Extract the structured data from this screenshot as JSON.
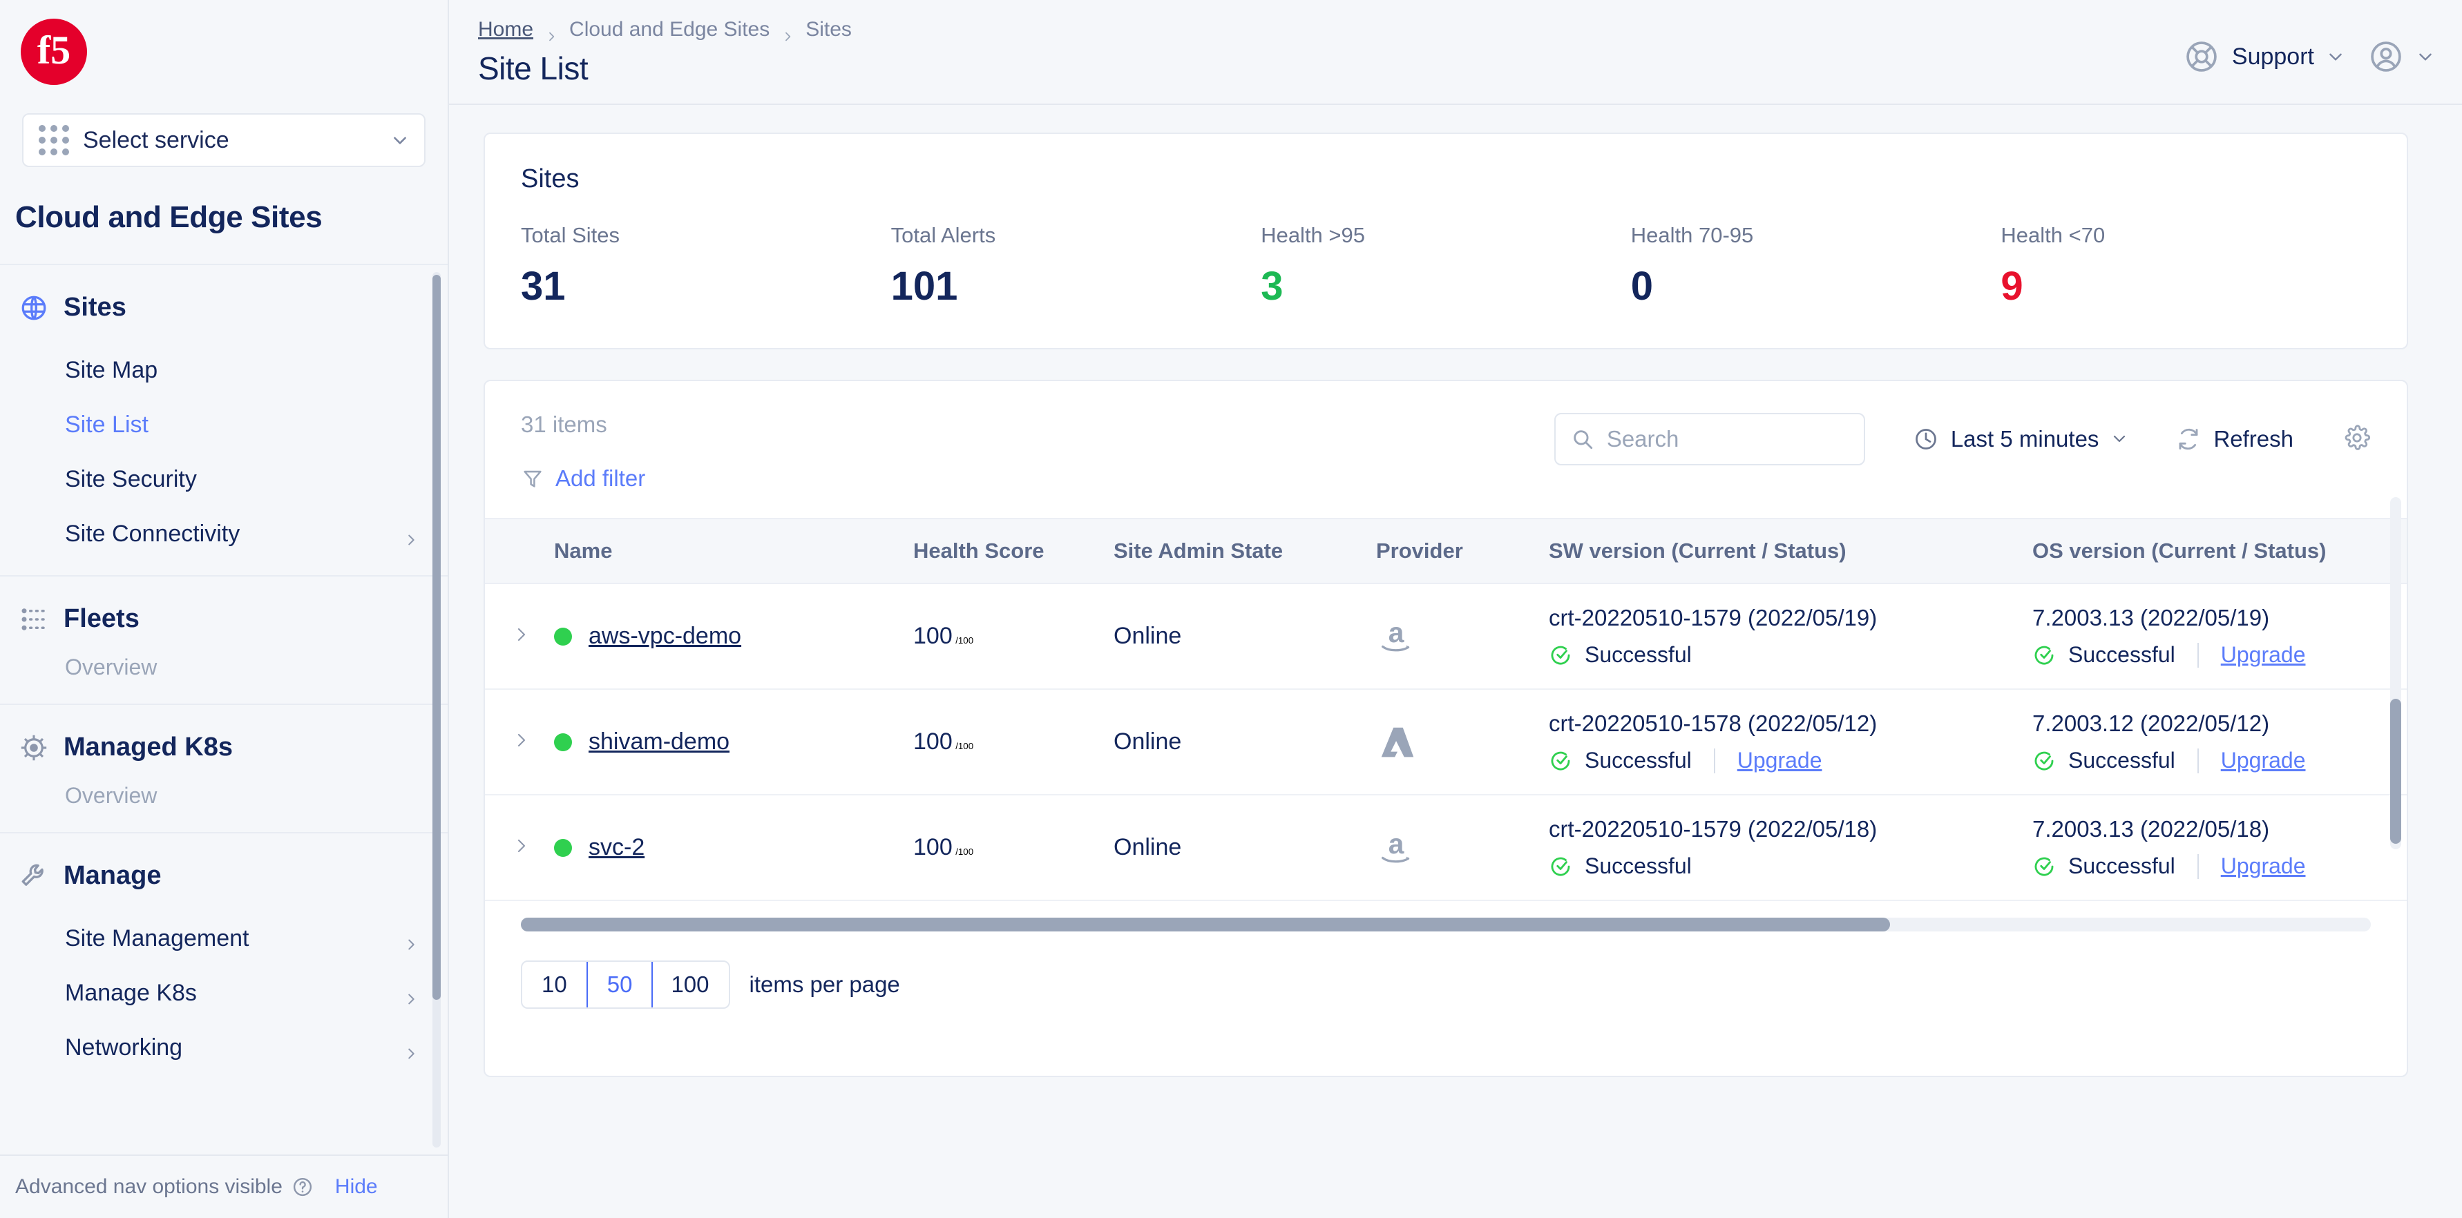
{
  "sidebar": {
    "logo": "f5-logo",
    "service_selector": {
      "label": "Select service",
      "icon": "grid-dots-icon"
    },
    "title": "Cloud and Edge Sites",
    "groups": [
      {
        "label": "Sites",
        "icon": "globe-icon",
        "items": [
          {
            "label": "Site Map",
            "active": false,
            "caret": false
          },
          {
            "label": "Site List",
            "active": true,
            "caret": false
          },
          {
            "label": "Site Security",
            "active": false,
            "caret": false
          },
          {
            "label": "Site Connectivity",
            "active": false,
            "caret": true
          }
        ]
      },
      {
        "label": "Fleets",
        "icon": "fleets-icon",
        "overview": "Overview",
        "items": []
      },
      {
        "label": "Managed K8s",
        "icon": "helm-icon",
        "overview": "Overview",
        "items": []
      },
      {
        "label": "Manage",
        "icon": "wrench-icon",
        "items": [
          {
            "label": "Site Management",
            "active": false,
            "caret": true
          },
          {
            "label": "Manage K8s",
            "active": false,
            "caret": true
          },
          {
            "label": "Networking",
            "active": false,
            "caret": true
          }
        ]
      }
    ],
    "footer": {
      "text": "Advanced nav options visible",
      "help_icon": "help-circle-icon",
      "hide_label": "Hide"
    }
  },
  "header": {
    "breadcrumb": [
      "Home",
      "Cloud and Edge Sites",
      "Sites"
    ],
    "page_title": "Site List",
    "support_label": "Support",
    "support_icon": "life-ring-icon",
    "avatar_icon": "user-circle-icon"
  },
  "stats": {
    "card_title": "Sites",
    "items": [
      {
        "label": "Total Sites",
        "value": "31",
        "color": "#13265c"
      },
      {
        "label": "Total Alerts",
        "value": "101",
        "color": "#13265c"
      },
      {
        "label": "Health >95",
        "value": "3",
        "color": "#1db954"
      },
      {
        "label": "Health 70-95",
        "value": "0",
        "color": "#13265c"
      },
      {
        "label": "Health <70",
        "value": "9",
        "color": "#e8112d"
      }
    ]
  },
  "toolbar": {
    "items_count": "31 items",
    "add_filter_label": "Add filter",
    "search_placeholder": "Search",
    "time_range_label": "Last 5 minutes",
    "refresh_label": "Refresh",
    "settings_icon": "gear-icon"
  },
  "table": {
    "columns": [
      "Name",
      "Health Score",
      "Site Admin State",
      "Provider",
      "SW version (Current / Status)",
      "OS version (Current / Status)"
    ],
    "rows": [
      {
        "name": "aws-vpc-demo",
        "status_dot": "green",
        "health_score": "100",
        "health_max": "/100",
        "admin_state": "Online",
        "provider": "aws",
        "sw_version": "crt-20220510-1579 (2022/05/19)",
        "sw_status": "Successful",
        "sw_upgrade": "",
        "os_version": "7.2003.13 (2022/05/19)",
        "os_status": "Successful",
        "os_upgrade": "Upgrade"
      },
      {
        "name": "shivam-demo",
        "status_dot": "green",
        "health_score": "100",
        "health_max": "/100",
        "admin_state": "Online",
        "provider": "azure",
        "sw_version": "crt-20220510-1578 (2022/05/12)",
        "sw_status": "Successful",
        "sw_upgrade": "Upgrade",
        "os_version": "7.2003.12 (2022/05/12)",
        "os_status": "Successful",
        "os_upgrade": "Upgrade"
      },
      {
        "name": "svc-2",
        "status_dot": "green",
        "health_score": "100",
        "health_max": "/100",
        "admin_state": "Online",
        "provider": "aws",
        "sw_version": "crt-20220510-1579 (2022/05/18)",
        "sw_status": "Successful",
        "sw_upgrade": "",
        "os_version": "7.2003.13 (2022/05/18)",
        "os_status": "Successful",
        "os_upgrade": "Upgrade"
      }
    ]
  },
  "pagination": {
    "options": [
      "10",
      "50",
      "100"
    ],
    "selected": "50",
    "suffix": "items per page"
  },
  "colors": {
    "brand_red": "#e4002b",
    "accent_blue": "#5b7cfa",
    "navy": "#13265c",
    "green": "#2fd04f",
    "danger": "#e8112d"
  }
}
